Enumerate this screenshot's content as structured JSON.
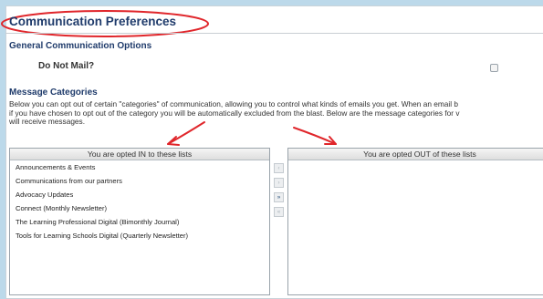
{
  "page": {
    "title": "Communication Preferences",
    "general_heading": "General Communication Options",
    "do_not_mail_label": "Do Not Mail?",
    "do_not_mail_checked": false,
    "message_heading": "Message Categories",
    "description_lines": [
      "Below you can opt out of certain \"categories\" of communication, allowing you to control what kinds of emails you get. When an email b",
      "if you have chosen to opt out of the category you will be automatically excluded from the blast. Below are the message categories for v",
      "will receive messages."
    ]
  },
  "lists": {
    "opted_in_header": "You are opted IN to these lists",
    "opted_out_header": "You are opted OUT of these lists",
    "opted_in_items": [
      "Announcements & Events",
      "Communications from our partners",
      "Advocacy Updates",
      "Connect (Monthly Newsletter)",
      "The Learning Professional Digital (Bimonthly Journal)",
      "Tools for Learning Schools Digital (Quarterly Newsletter)"
    ],
    "opted_out_items": []
  },
  "controls": {
    "move_right_label": "»",
    "move_left_label": "«",
    "move_one_right_label": "›",
    "move_one_left_label": "‹"
  },
  "annotations": {
    "color": "#e0262b"
  }
}
